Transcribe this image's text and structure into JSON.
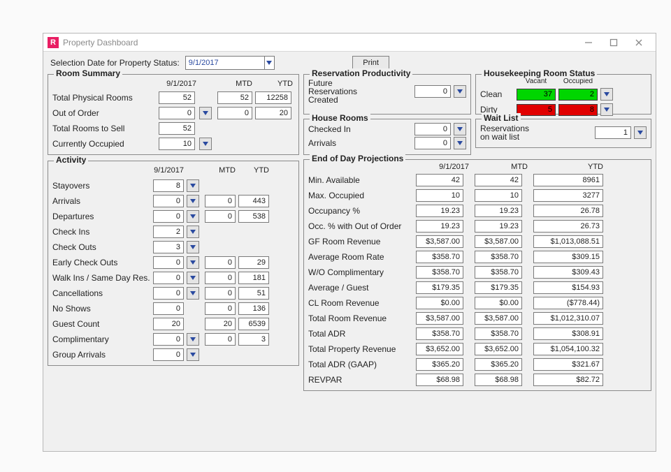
{
  "window": {
    "title": "Property Dashboard",
    "icon_letter": "R"
  },
  "toolbar": {
    "selection_label": "Selection Date for Property Status:",
    "selection_date": "9/1/2017",
    "print_label": "Print"
  },
  "room_summary": {
    "legend": "Room Summary",
    "col_date": "9/1/2017",
    "col_mtd": "MTD",
    "col_ytd": "YTD",
    "rows": {
      "phys": {
        "label": "Total Physical Rooms",
        "day": "52",
        "mtd": "52",
        "ytd": "12258"
      },
      "out": {
        "label": "Out of Order",
        "day": "0",
        "mtd": "0",
        "ytd": "20"
      },
      "sell": {
        "label": "Total Rooms to Sell",
        "day": "52"
      },
      "occ": {
        "label": "Currently Occupied",
        "day": "10"
      }
    }
  },
  "activity": {
    "legend": "Activity",
    "col_date": "9/1/2017",
    "col_mtd": "MTD",
    "col_ytd": "YTD",
    "rows": {
      "stay": {
        "label": "Stayovers",
        "day": "8"
      },
      "arr": {
        "label": "Arrivals",
        "day": "0",
        "mtd": "0",
        "ytd": "443"
      },
      "dep": {
        "label": "Departures",
        "day": "0",
        "mtd": "0",
        "ytd": "538"
      },
      "cin": {
        "label": "Check Ins",
        "day": "2"
      },
      "cout": {
        "label": "Check Outs",
        "day": "3"
      },
      "eco": {
        "label": "Early Check Outs",
        "day": "0",
        "mtd": "0",
        "ytd": "29"
      },
      "walk": {
        "label": "Walk Ins / Same Day Res.",
        "day": "0",
        "mtd": "0",
        "ytd": "181"
      },
      "canc": {
        "label": "Cancellations",
        "day": "0",
        "mtd": "0",
        "ytd": "51"
      },
      "nos": {
        "label": "No Shows",
        "day": "0",
        "mtd": "0",
        "ytd": "136"
      },
      "gc": {
        "label": "Guest Count",
        "day": "20",
        "mtd": "20",
        "ytd": "6539"
      },
      "comp": {
        "label": "Complimentary",
        "day": "0",
        "mtd": "0",
        "ytd": "3"
      },
      "garr": {
        "label": "Group Arrivals",
        "day": "0"
      }
    }
  },
  "res_prod": {
    "legend": "Reservation Productivity",
    "label": "Future\nReservations\nCreated",
    "value": "0"
  },
  "house_rooms": {
    "legend": "House Rooms",
    "checked_in_label": "Checked In",
    "checked_in_val": "0",
    "arrivals_label": "Arrivals",
    "arrivals_val": "0"
  },
  "housekeeping": {
    "legend": "Housekeeping Room Status",
    "col_vacant": "Vacant",
    "col_occupied": "Occupied",
    "clean_label": "Clean",
    "clean_vacant": "37",
    "clean_occ": "2",
    "dirty_label": "Dirty",
    "dirty_vacant": "5",
    "dirty_occ": "8"
  },
  "wait_list": {
    "legend": "Wait List",
    "label": "Reservations\non wait list",
    "value": "1"
  },
  "eod": {
    "legend": "End of Day Projections",
    "col_date": "9/1/2017",
    "col_mtd": "MTD",
    "col_ytd": "YTD",
    "rows": {
      "minavail": {
        "label": "Min. Available",
        "day": "42",
        "mtd": "42",
        "ytd": "8961"
      },
      "maxocc": {
        "label": "Max. Occupied",
        "day": "10",
        "mtd": "10",
        "ytd": "3277"
      },
      "occpct": {
        "label": "Occupancy %",
        "day": "19.23",
        "mtd": "19.23",
        "ytd": "26.78"
      },
      "occooo": {
        "label": "Occ. % with Out of Order",
        "day": "19.23",
        "mtd": "19.23",
        "ytd": "26.73"
      },
      "gfrev": {
        "label": "GF Room Revenue",
        "day": "$3,587.00",
        "mtd": "$3,587.00",
        "ytd": "$1,013,088.51"
      },
      "avgrate": {
        "label": "Average Room Rate",
        "day": "$358.70",
        "mtd": "$358.70",
        "ytd": "$309.15"
      },
      "wocomp": {
        "label": " W/O Complimentary",
        "day": "$358.70",
        "mtd": "$358.70",
        "ytd": "$309.43"
      },
      "avgguest": {
        "label": "Average / Guest",
        "day": "$179.35",
        "mtd": "$179.35",
        "ytd": "$154.93"
      },
      "clrev": {
        "label": "CL Room Revenue",
        "day": "$0.00",
        "mtd": "$0.00",
        "ytd": "($778.44)"
      },
      "totrev": {
        "label": "Total Room Revenue",
        "day": "$3,587.00",
        "mtd": "$3,587.00",
        "ytd": "$1,012,310.07"
      },
      "totadr": {
        "label": "Total ADR",
        "day": "$358.70",
        "mtd": "$358.70",
        "ytd": "$308.91"
      },
      "tpr": {
        "label": "Total Property Revenue",
        "day": "$3,652.00",
        "mtd": "$3,652.00",
        "ytd": "$1,054,100.32"
      },
      "gaap": {
        "label": "Total ADR (GAAP)",
        "day": "$365.20",
        "mtd": "$365.20",
        "ytd": "$321.67"
      },
      "revpar": {
        "label": "REVPAR",
        "day": "$68.98",
        "mtd": "$68.98",
        "ytd": "$82.72"
      }
    }
  }
}
